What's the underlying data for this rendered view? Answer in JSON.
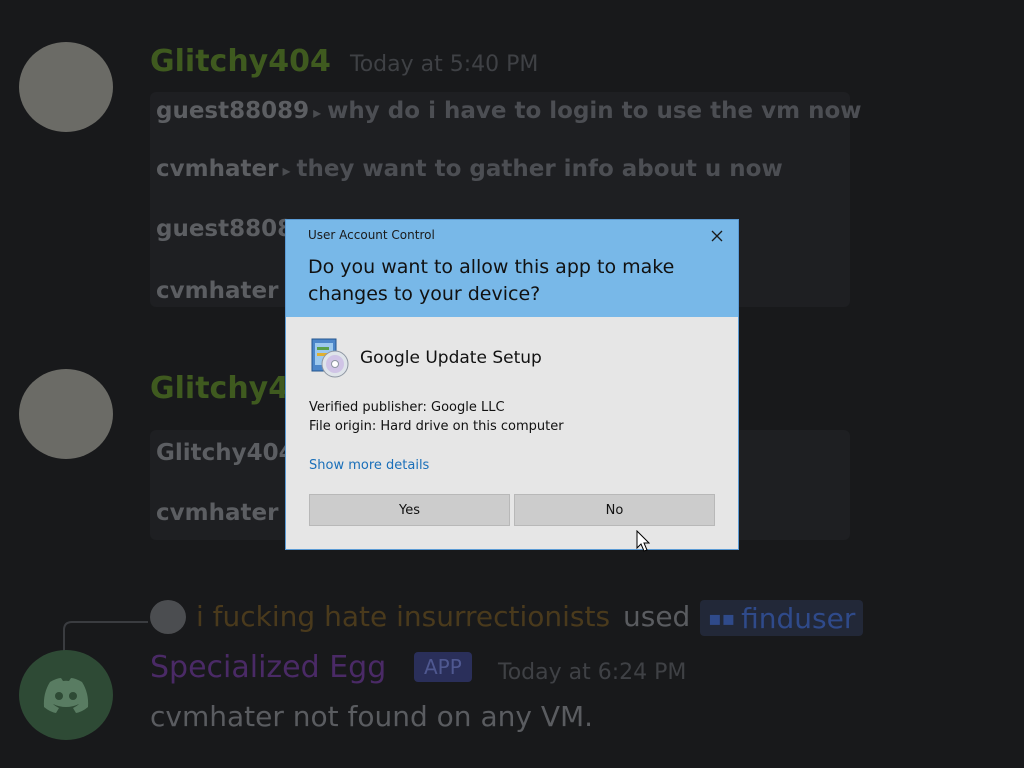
{
  "chat": {
    "msg1": {
      "user": "Glitchy404",
      "time": "Today at 5:40 PM",
      "lines": [
        {
          "who": "guest88089",
          "text": "why do i have to login to use the vm now"
        },
        {
          "who": "cvmhater",
          "text": "they want to gather info about u now"
        },
        {
          "who": "guest8808",
          "text": ""
        },
        {
          "who": "cvmhater",
          "text": ""
        }
      ]
    },
    "msg2": {
      "user": "Glitchy4",
      "lines": [
        {
          "who": "Glitchy404",
          "text": ""
        },
        {
          "who": "cvmhater",
          "text": ""
        }
      ]
    },
    "reply": {
      "author": "i fucking hate insurrectionists",
      "used": "used",
      "command": "finduser"
    },
    "bot": {
      "name": "Specialized Egg",
      "badge": "APP",
      "time": "Today at 6:24 PM",
      "text": "cvmhater not found on any VM."
    }
  },
  "colors": {
    "username_green": "#3f5a1f",
    "bot_purple": "#4a2a66",
    "command_blue": "#2f4a8a"
  },
  "uac": {
    "caption": "User Account Control",
    "question": "Do you want to allow this app to make changes to your device?",
    "app_icon": "installer-disc-icon",
    "app_name": "Google Update Setup",
    "publisher": "Verified publisher: Google LLC",
    "origin": "File origin: Hard drive on this computer",
    "more_details": "Show more details",
    "yes": "Yes",
    "no": "No",
    "header_color": "#78b8e8",
    "body_color": "#e6e6e6",
    "link_color": "#1a6fb9"
  }
}
